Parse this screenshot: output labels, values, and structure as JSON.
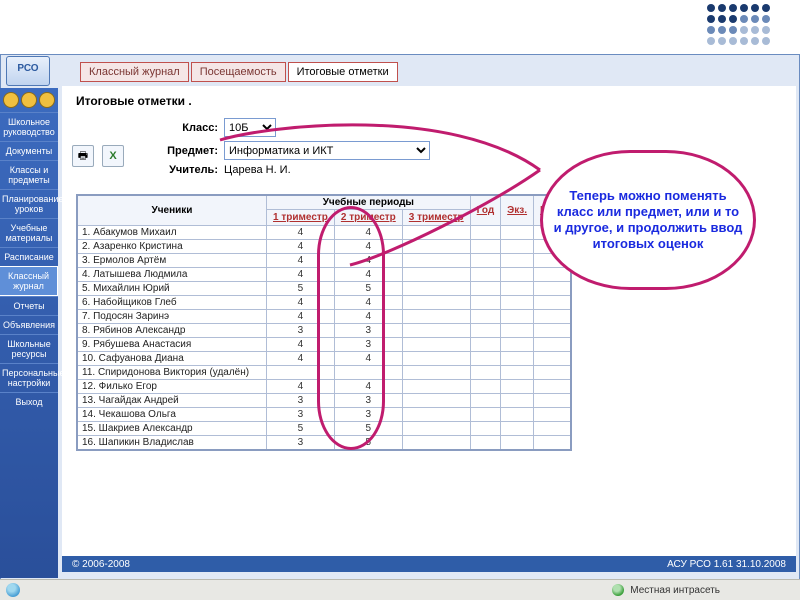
{
  "logo": "РСО",
  "tabs": {
    "journal": "Классный журнал",
    "attendance": "Посещаемость",
    "final": "Итоговые отметки"
  },
  "page_title": "Итоговые отметки .",
  "form": {
    "class_label": "Класс:",
    "class_value": "10Б",
    "subject_label": "Предмет:",
    "subject_value": "Информатика и ИКТ",
    "teacher_label": "Учитель:",
    "teacher_value": "Царева Н. И."
  },
  "table": {
    "students_header": "Ученики",
    "periods_header": "Учебные периоды",
    "period1": "1 триместр",
    "period2": "2 триместр",
    "period3": "3 триместр",
    "year": "Год",
    "exam": "Экз.",
    "final": "Итог."
  },
  "students": [
    {
      "n": "1.",
      "name": "Абакумов Михаил",
      "g1": "4",
      "g2": "4"
    },
    {
      "n": "2.",
      "name": "Азаренко Кристина",
      "g1": "4",
      "g2": "4"
    },
    {
      "n": "3.",
      "name": "Ермолов Артём",
      "g1": "4",
      "g2": "4"
    },
    {
      "n": "4.",
      "name": "Латышева Людмила",
      "g1": "4",
      "g2": "4"
    },
    {
      "n": "5.",
      "name": "Михайлин Юрий",
      "g1": "5",
      "g2": "5"
    },
    {
      "n": "6.",
      "name": "Набойщиков Глеб",
      "g1": "4",
      "g2": "4"
    },
    {
      "n": "7.",
      "name": "Подосян Заринэ",
      "g1": "4",
      "g2": "4"
    },
    {
      "n": "8.",
      "name": "Рябинов Александр",
      "g1": "3",
      "g2": "3"
    },
    {
      "n": "9.",
      "name": "Рябушева Анастасия",
      "g1": "4",
      "g2": "3"
    },
    {
      "n": "10.",
      "name": "Сафуанова Диана",
      "g1": "4",
      "g2": "4"
    },
    {
      "n": "11.",
      "name": "Спиридонова Виктория (удалён)",
      "g1": "",
      "g2": ""
    },
    {
      "n": "12.",
      "name": "Филько Егор",
      "g1": "4",
      "g2": "4"
    },
    {
      "n": "13.",
      "name": "Чагайдак Андрей",
      "g1": "3",
      "g2": "3"
    },
    {
      "n": "14.",
      "name": "Чекашова Ольга",
      "g1": "3",
      "g2": "3"
    },
    {
      "n": "15.",
      "name": "Шакриев Александр",
      "g1": "5",
      "g2": "5"
    },
    {
      "n": "16.",
      "name": "Шапикин Владислав",
      "g1": "3",
      "g2": "5"
    }
  ],
  "sidebar": [
    "Школьное руководство",
    "Документы",
    "Классы и предметы",
    "Планирование уроков",
    "Учебные материалы",
    "Расписание",
    "Классный журнал",
    "Отчеты",
    "Объявления",
    "Школьные ресурсы",
    "Персональные настройки",
    "Выход"
  ],
  "callout": "Теперь можно поменять класс или предмет, или и то и другое, и продолжить ввод итоговых оценок",
  "footer": {
    "copyright": "© 2006-2008",
    "version": "АСУ РСО 1.61   31.10.2008"
  },
  "status": "Местная интрасеть",
  "active_sidebar_index": 6
}
